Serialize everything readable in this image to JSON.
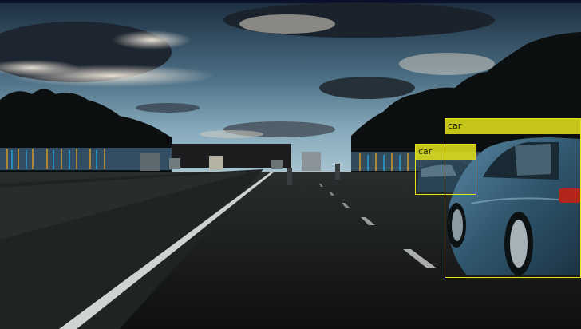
{
  "scene": {
    "sky_top": "#1e3447",
    "sky_horizon": "#8fb3c4",
    "road_color": "#1a1c1c",
    "tree_color": "#0c1010"
  },
  "detections": {
    "color": "#e5e51a",
    "items": [
      {
        "label": "car"
      },
      {
        "label": "car"
      }
    ]
  }
}
